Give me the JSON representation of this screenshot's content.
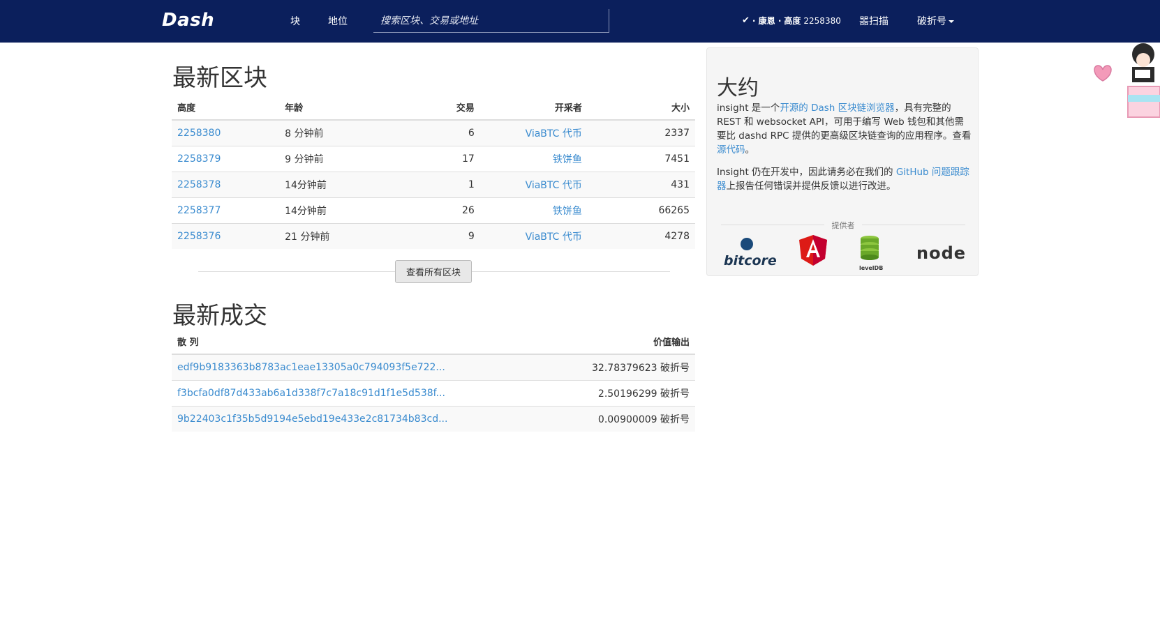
{
  "navbar": {
    "brand": "Dash",
    "links": {
      "blocks": "块",
      "address": "地位"
    },
    "search_placeholder": "搜索区块、交易或地址",
    "status": {
      "conn": "· 康恩 ·",
      "height_label": "高度",
      "height_value": "2258380"
    },
    "scan": "噐扫描",
    "currency": "破折号"
  },
  "latest_blocks": {
    "title": "最新区块",
    "columns": [
      "高度",
      "年龄",
      "交易",
      "开采者",
      "大小"
    ],
    "rows": [
      {
        "height": "2258380",
        "age": "8 分钟前",
        "txs": "6",
        "miner": "ViaBTC 代币",
        "size": "2337"
      },
      {
        "height": "2258379",
        "age": "9 分钟前",
        "txs": "17",
        "miner": "铁饼鱼",
        "size": "7451"
      },
      {
        "height": "2258378",
        "age": "14分钟前",
        "txs": "1",
        "miner": "ViaBTC 代币",
        "size": "431"
      },
      {
        "height": "2258377",
        "age": "14分钟前",
        "txs": "26",
        "miner": "铁饼鱼",
        "size": "66265"
      },
      {
        "height": "2258376",
        "age": "21 分钟前",
        "txs": "9",
        "miner": "ViaBTC 代币",
        "size": "4278"
      }
    ],
    "view_all": "查看所有区块"
  },
  "latest_transactions": {
    "title": "最新成交",
    "columns": [
      "散 列",
      "价值输出"
    ],
    "rows": [
      {
        "hash": "edf9b9183363b8783ac1eae13305a0c794093f5e722...",
        "value": "32.78379623 破折号"
      },
      {
        "hash": "f3bcfa0df87d433ab6a1d338f7c7a18c91d1f1e5d538f...",
        "value": "2.50196299 破折号"
      },
      {
        "hash": "9b22403c1f35b5d9194e5ebd19e433e2c81734b83cd...",
        "value": "0.00900009 破折号"
      }
    ]
  },
  "about": {
    "title": "大约",
    "p1": {
      "a": "insight 是一个",
      "link1": "开源的 Dash 区块链浏览器",
      "b": "，具有完整的 REST 和 websocket API，可用于编写 Web 钱包和其他需要比 dashd RPC 提供的更高级区块链查询的应用程序。查看",
      "link2": "源代码",
      "c": "。"
    },
    "p2": {
      "a": "Insight 仍在开发中，因此请务必在我们的 ",
      "link": "GitHub 问题跟踪器",
      "b": "上报告任何错误并提供反馈以进行改进。"
    },
    "powered_by": "提供者",
    "logos": {
      "bitcore": "bitcore",
      "leveldb": "levelDB",
      "node": "node"
    }
  }
}
